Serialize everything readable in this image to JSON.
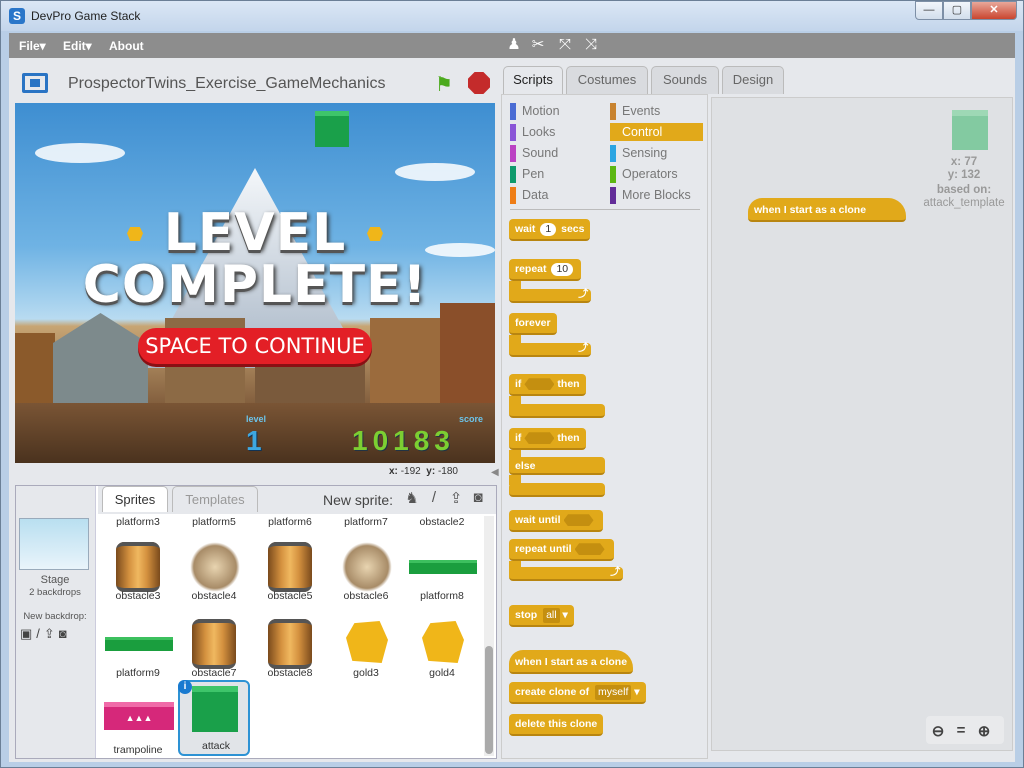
{
  "window": {
    "title": "DevPro Game Stack",
    "app_icon": "S",
    "controls": {
      "minimize": "—",
      "maximize": "▢",
      "close": "✕"
    }
  },
  "menu": {
    "file": "File▾",
    "edit": "Edit▾",
    "about": "About"
  },
  "stage": {
    "project_title": "ProspectorTwins_Exercise_GameMechanics",
    "level_line1": "LEVEL",
    "level_line2": "COMPLETE!",
    "continue_btn": "SPACE TO CONTINUE",
    "level_label": "level",
    "level_value": "1",
    "score_label": "score",
    "score_value": "10183",
    "coords": {
      "x_label": "x:",
      "x": "-192",
      "y_label": "y:",
      "y": "-180"
    }
  },
  "sprite_pane": {
    "stage_label": "Stage",
    "backdrops": "2 backdrops",
    "new_backdrop": "New backdrop:",
    "tabs": {
      "sprites": "Sprites",
      "templates": "Templates"
    },
    "new_sprite": "New sprite:",
    "top_row": [
      "platform3",
      "platform5",
      "platform6",
      "platform7",
      "obstacle2"
    ],
    "sprites": [
      {
        "name": "obstacle3",
        "kind": "barrel"
      },
      {
        "name": "obstacle4",
        "kind": "explode"
      },
      {
        "name": "obstacle5",
        "kind": "barrel"
      },
      {
        "name": "obstacle6",
        "kind": "explode"
      },
      {
        "name": "platform8",
        "kind": "platform"
      },
      {
        "name": "platform9",
        "kind": "platform"
      },
      {
        "name": "obstacle7",
        "kind": "barrel"
      },
      {
        "name": "obstacle8",
        "kind": "barrel"
      },
      {
        "name": "gold3",
        "kind": "gold"
      },
      {
        "name": "gold4",
        "kind": "gold"
      },
      {
        "name": "trampoline",
        "kind": "trampoline"
      },
      {
        "name": "attack",
        "kind": "green-square",
        "selected": true
      }
    ]
  },
  "tabs": {
    "scripts": "Scripts",
    "costumes": "Costumes",
    "sounds": "Sounds",
    "design": "Design"
  },
  "categories": {
    "left": [
      {
        "label": "Motion",
        "color": "#4a6cd4"
      },
      {
        "label": "Looks",
        "color": "#8a55d7"
      },
      {
        "label": "Sound",
        "color": "#bb42c3"
      },
      {
        "label": "Pen",
        "color": "#0e9a6c"
      },
      {
        "label": "Data",
        "color": "#ee7d16"
      }
    ],
    "right": [
      {
        "label": "Events",
        "color": "#c88330"
      },
      {
        "label": "Control",
        "color": "#e1a91a"
      },
      {
        "label": "Sensing",
        "color": "#2ca5e2"
      },
      {
        "label": "Operators",
        "color": "#5cb712"
      },
      {
        "label": "More Blocks",
        "color": "#632d99"
      }
    ]
  },
  "blocks": {
    "wait": "wait",
    "wait_val": "1",
    "wait_unit": "secs",
    "repeat": "repeat",
    "repeat_val": "10",
    "forever": "forever",
    "if": "if",
    "then": "then",
    "else": "else",
    "wait_until": "wait until",
    "repeat_until": "repeat until",
    "stop": "stop",
    "stop_opt": "all",
    "clone_hat": "when I start as a clone",
    "create_clone": "create clone of",
    "create_clone_opt": "myself",
    "delete_clone": "delete this clone"
  },
  "script_area": {
    "hat_block": "when I start as a clone",
    "x_label": "x:",
    "x": "77",
    "y_label": "y:",
    "y": "132",
    "based_on": "based on:",
    "template": "attack_template"
  }
}
